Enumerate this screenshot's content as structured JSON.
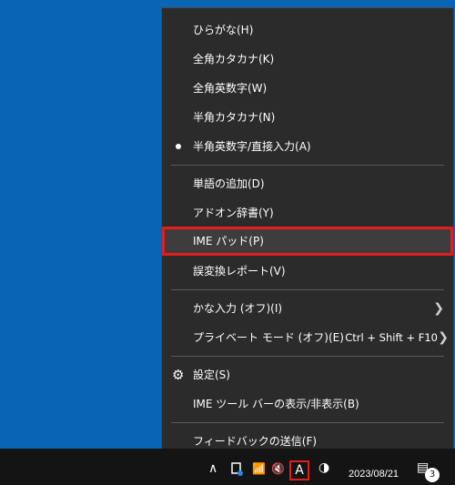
{
  "menu": {
    "items": [
      {
        "label": "ひらがな(H)"
      },
      {
        "label": "全角カタカナ(K)"
      },
      {
        "label": "全角英数字(W)"
      },
      {
        "label": "半角カタカナ(N)"
      },
      {
        "label": "半角英数字/直接入力(A)",
        "selected": true
      },
      {
        "label": "単語の追加(D)"
      },
      {
        "label": "アドオン辞書(Y)"
      },
      {
        "label": "IME パッド(P)",
        "highlighted": true
      },
      {
        "label": "誤変換レポート(V)"
      },
      {
        "label": "かな入力 (オフ)(I)",
        "submenu": true
      },
      {
        "label": "プライベート モード (オフ)(E)",
        "shortcut": "Ctrl + Shift + F10",
        "submenu": true
      },
      {
        "label": "設定(S)",
        "icon": "gear-icon"
      },
      {
        "label": "IME ツール バーの表示/非表示(B)"
      },
      {
        "label": "フィードバックの送信(F)"
      }
    ]
  },
  "taskbar": {
    "ime_indicator": "A",
    "date": "2023/08/21",
    "notification_count": "3"
  },
  "colors": {
    "desktop": "#0a64b6",
    "menu_bg": "#2b2b2b",
    "highlight_border": "#e31d1d",
    "taskbar": "#141414"
  }
}
